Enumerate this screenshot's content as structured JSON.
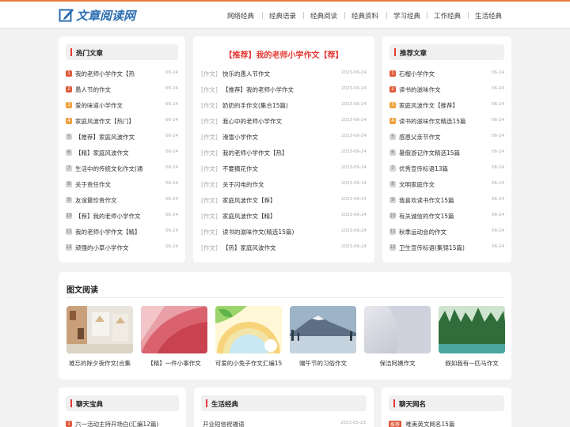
{
  "site": {
    "logo_text": "文章阅读网"
  },
  "nav": [
    "网络经典",
    "经典语录",
    "经典阅读",
    "经典资料",
    "学习经典",
    "工作经典",
    "生活经典"
  ],
  "hot": {
    "title": "热门文章",
    "items": [
      {
        "n": "1",
        "t": "我的老师小学作文【热",
        "d": "06-24"
      },
      {
        "n": "2",
        "t": "愚人节的作文",
        "d": "06-24"
      },
      {
        "n": "3",
        "t": "爱的味道小学作文",
        "d": "06-24"
      },
      {
        "n": "4",
        "t": "家庭风波作文【热门】",
        "d": "06-24"
      },
      {
        "n": "5",
        "t": "【推荐】家庭风波作文",
        "d": "06-24"
      },
      {
        "n": "6",
        "t": "【精】家庭风波作文",
        "d": "06-24"
      },
      {
        "n": "7",
        "t": "生活中的传统文化作文(通",
        "d": "06-24"
      },
      {
        "n": "8",
        "t": "关于责任作文",
        "d": "06-24"
      },
      {
        "n": "9",
        "t": "友谊最珍贵作文",
        "d": "06-24"
      },
      {
        "n": "10",
        "t": "【荐】我的老师小学作文",
        "d": "06-24"
      },
      {
        "n": "11",
        "t": "我的老师小学作文【精】",
        "d": "06-24"
      },
      {
        "n": "12",
        "t": "顽强的小草小学作文",
        "d": "06-24"
      }
    ]
  },
  "featured": {
    "title": "【推荐】我的老师小学作文【荐】",
    "tag": "[作文]",
    "items": [
      {
        "t": "快乐的愚人节作文",
        "d": "2023-06-24"
      },
      {
        "t": "【推荐】我的老师小学作文",
        "d": "2023-06-24"
      },
      {
        "t": "奶奶的手作文(集合15篇)",
        "d": "2023-06-24"
      },
      {
        "t": "我心中的老师小学作文",
        "d": "2023-06-24"
      },
      {
        "t": "滑雪小学作文",
        "d": "2023-06-24"
      },
      {
        "t": "我的老师小学作文【热】",
        "d": "2023-06-24"
      },
      {
        "t": "不要摘花作文",
        "d": "2023-06-24"
      },
      {
        "t": "关于闪电的作文",
        "d": "2023-06-24"
      },
      {
        "t": "家庭风波作文【荐】",
        "d": "2023-06-24"
      },
      {
        "t": "家庭风波作文【精】",
        "d": "2023-06-24"
      },
      {
        "t": "读书的滋味作文(精选15篇)",
        "d": "2023-06-24"
      },
      {
        "t": "【热】家庭风波作文",
        "d": "2023-06-24"
      }
    ]
  },
  "recommend": {
    "title": "推荐文章",
    "items": [
      {
        "n": "1",
        "t": "石榴小学作文",
        "d": "06-24"
      },
      {
        "n": "2",
        "t": "读书的滋味作文",
        "d": "06-24"
      },
      {
        "n": "3",
        "t": "家庭风波作文【推荐】",
        "d": "06-24"
      },
      {
        "n": "4",
        "t": "读书的滋味作文精选15篇",
        "d": "06-24"
      },
      {
        "n": "5",
        "t": "感恩父亲节作文",
        "d": "06-24"
      },
      {
        "n": "6",
        "t": "暑假游记作文精选15篇",
        "d": "06-24"
      },
      {
        "n": "7",
        "t": "优秀宣传标语13篇",
        "d": "06-24"
      },
      {
        "n": "8",
        "t": "文明家庭作文",
        "d": "06-24"
      },
      {
        "n": "9",
        "t": "我喜欢读书作文15篇",
        "d": "06-24"
      },
      {
        "n": "10",
        "t": "有关诚信的作文15篇",
        "d": "06-24"
      },
      {
        "n": "11",
        "t": "秋季运动会的作文",
        "d": "06-24"
      },
      {
        "n": "12",
        "t": "卫生宣传标语(集锦15篇)",
        "d": "06-24"
      }
    ]
  },
  "gallery": {
    "title": "图文阅读",
    "items": [
      {
        "cap": "难忘的除夕夜作文(合集"
      },
      {
        "cap": "【精】一件小事作文"
      },
      {
        "cap": "可爱的小兔子作文汇编15"
      },
      {
        "cap": "端午节的习俗作文"
      },
      {
        "cap": "保洁阿姨作文"
      },
      {
        "cap": "假如我有一匹马作文"
      }
    ]
  },
  "bottom": {
    "left": {
      "title": "聊天宝典",
      "first_num": "1",
      "first": "六一活动主持开场白(汇编12篇)"
    },
    "mid": {
      "title": "生活经典",
      "first": "开业短信祝福语",
      "first_date": "2023-05-23"
    },
    "right": {
      "title": "聊天网名",
      "first_badge": "推荐",
      "first": "唯美英文网名15篇"
    }
  },
  "colors": {
    "accent": "#e53935",
    "orange": "#e57a3a",
    "logo": "#2b6db2"
  }
}
